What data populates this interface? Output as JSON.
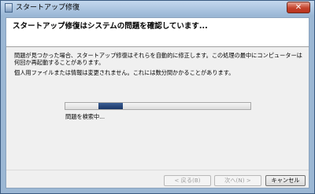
{
  "window": {
    "title": "スタートアップ修復",
    "close_symbol": "✕"
  },
  "header": {
    "text": "スタートアップ修復はシステムの問題を確認しています..."
  },
  "content": {
    "description_1": "問題が見つかった場合、スタートアップ修復はそれらを自動的に修正します。この処理の最中にコンピューターは何回か再起動することがあります。",
    "description_2": "個人用ファイルまたは情報は変更されません。これには数分間かかることがあります。"
  },
  "progress": {
    "indicator_start": 0.18,
    "indicator_width": 0.13,
    "status": "問題を検索中..."
  },
  "buttons": {
    "back": "< 戻る(B)",
    "next": "次へ(N) >",
    "cancel": "キャンセル"
  }
}
